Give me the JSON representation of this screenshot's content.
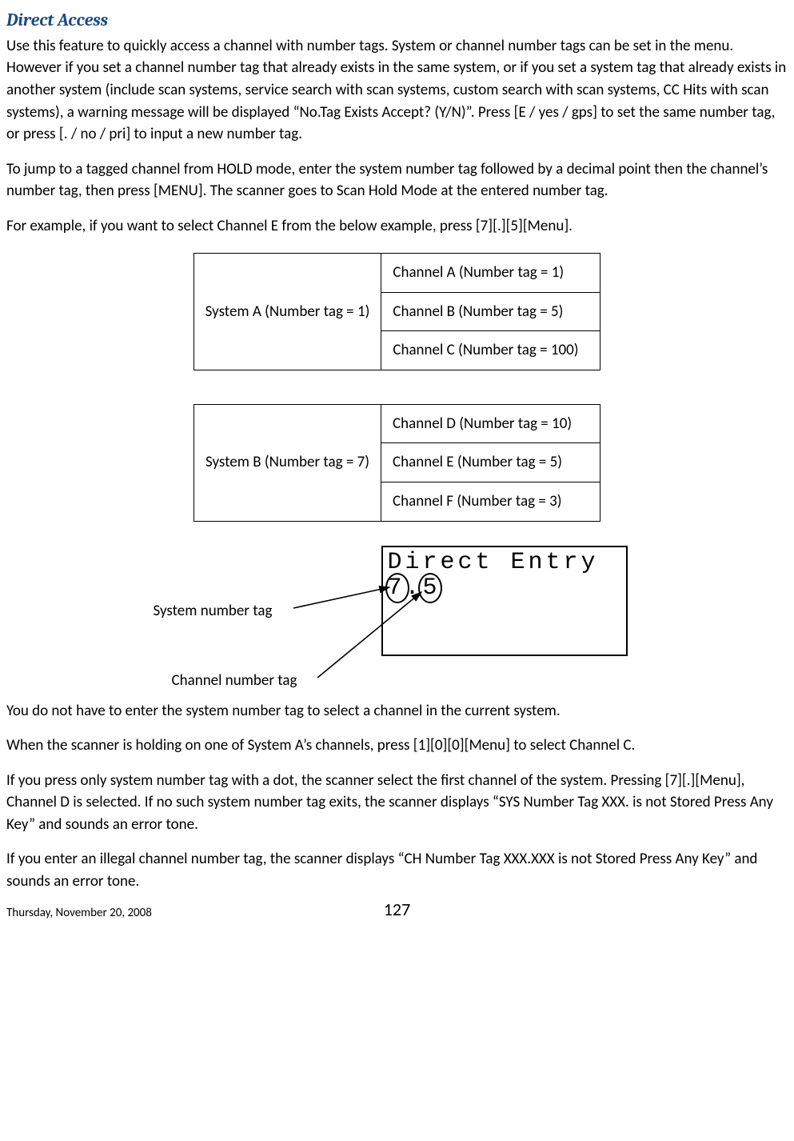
{
  "heading": "Direct Access",
  "para1": "Use this feature to quickly access a channel with number tags. System or channel number tags can be set in the menu. However if you set a channel number tag that already exists in the same system, or if you set a system tag that already exists in another system (include scan systems, service search with scan systems, custom search with scan systems, CC Hits with scan systems), a warning message will be displayed “No.Tag Exists Accept? (Y/N)”. Press [E / yes / gps] to set the same number tag, or press [. / no / pri] to input a new number tag.",
  "para2": "To jump to a tagged channel from HOLD mode, enter the system number tag followed by a decimal point then the channel’s number tag, then press [MENU]. The scanner goes to Scan Hold Mode at the entered number tag.",
  "para3": "For example, if you want to select Channel E from the below example, press [7][.][5][Menu].",
  "tableA": {
    "system": "System A (Number tag = 1)",
    "channels": [
      "Channel A (Number tag = 1)",
      "Channel B (Number tag = 5)",
      "Channel C (Number tag = 100)"
    ]
  },
  "tableB": {
    "system": "System B (Number tag = 7)",
    "channels": [
      "Channel D (Number tag = 10)",
      "Channel E (Number tag = 5)",
      "Channel F (Number tag = 3)"
    ]
  },
  "lcd": {
    "line1": "Direct Entry",
    "line2": "7.5"
  },
  "label_system_tag": "System number tag",
  "label_channel_tag": "Channel number tag",
  "para4": "You do not have to enter the system number tag to select a channel in the current system.",
  "para5": "When the scanner is holding on one of System A’s channels, press [1][0][0][Menu] to select Channel C.",
  "para6": "If you press only system number tag with a dot, the scanner select the first channel of the system. Pressing [7][.][Menu], Channel D is selected. If no such system number tag exits, the scanner displays “SYS Number Tag XXX. is not Stored Press Any Key” and sounds an error tone.",
  "para7": "If you enter an illegal channel number tag, the scanner displays “CH Number Tag XXX.XXX is not Stored Press Any Key” and sounds an error tone.",
  "footer_date": "Thursday, November 20, 2008",
  "page_number": "127"
}
